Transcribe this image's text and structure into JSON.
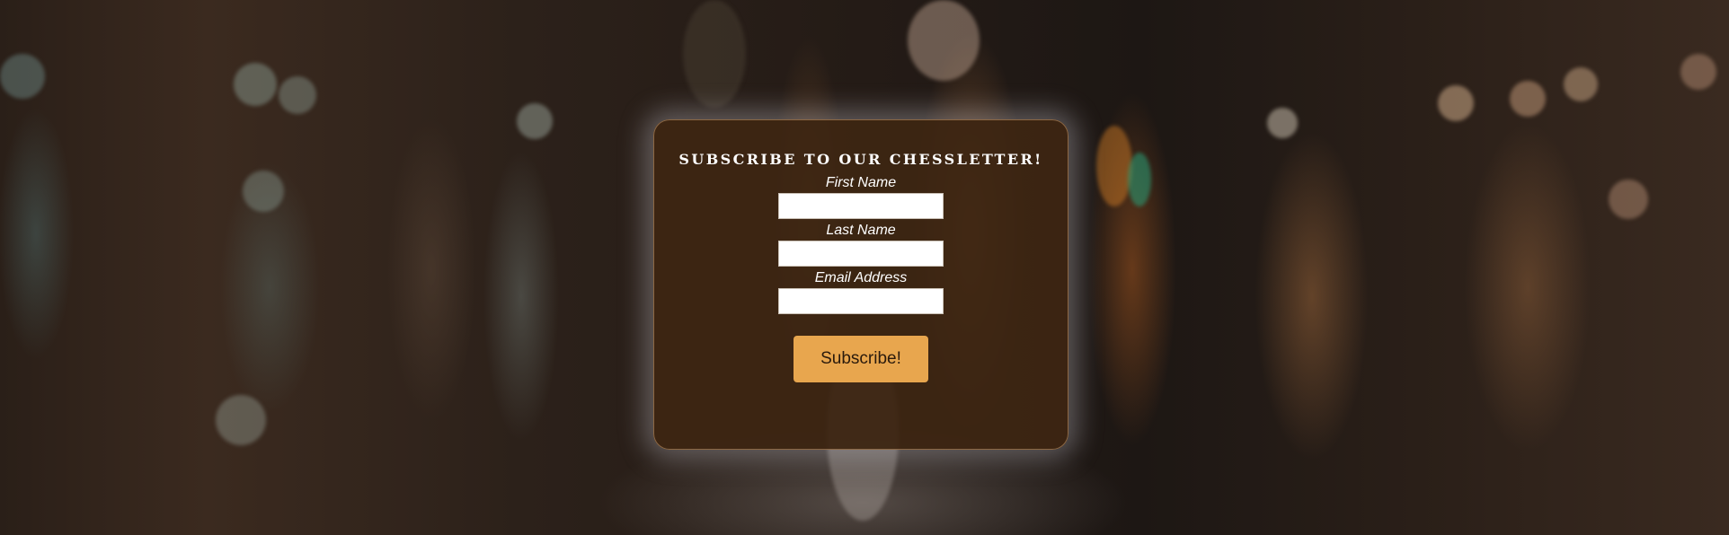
{
  "subscribe": {
    "title": "Subscribe to our Chessletter!",
    "fields": [
      {
        "label": "First Name",
        "value": "",
        "placeholder": ""
      },
      {
        "label": "Last Name",
        "value": "",
        "placeholder": ""
      },
      {
        "label": "Email Address",
        "value": "",
        "placeholder": ""
      }
    ],
    "submit_label": "Subscribe!"
  },
  "colors": {
    "card_background": "#3e2612",
    "button_background": "#e8a64e",
    "title_text": "#ffffff"
  }
}
